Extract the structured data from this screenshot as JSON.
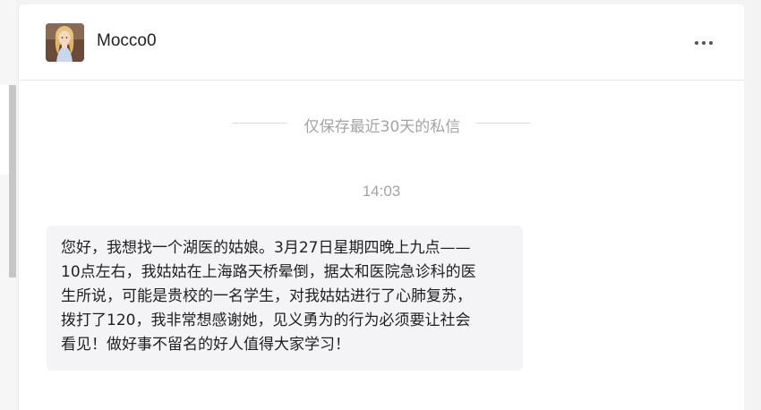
{
  "chat": {
    "username": "Mocco0",
    "notice": "仅保存最近30天的私信",
    "timestamp": "14:03",
    "message": "您好，我想找一个湖医的姑娘。3月27日星期四晚上九点——\n10点左右，我姑姑在上海路天桥晕倒，据太和医院急诊科的医\n生所说，可能是贵校的一名学生，对我姑姑进行了心肺复苏，\n拨打了120，我非常想感谢她，见义勇为的行为必须要让社会\n看见！做好事不留名的好人值得大家学习！"
  },
  "icons": {
    "more": "more-horizontal-icon",
    "avatar": "user-avatar-image"
  },
  "colors": {
    "background": "#f3f3f4",
    "window": "#ffffff",
    "bubble": "#f4f4f6",
    "muted_text": "#a3a3a8"
  }
}
